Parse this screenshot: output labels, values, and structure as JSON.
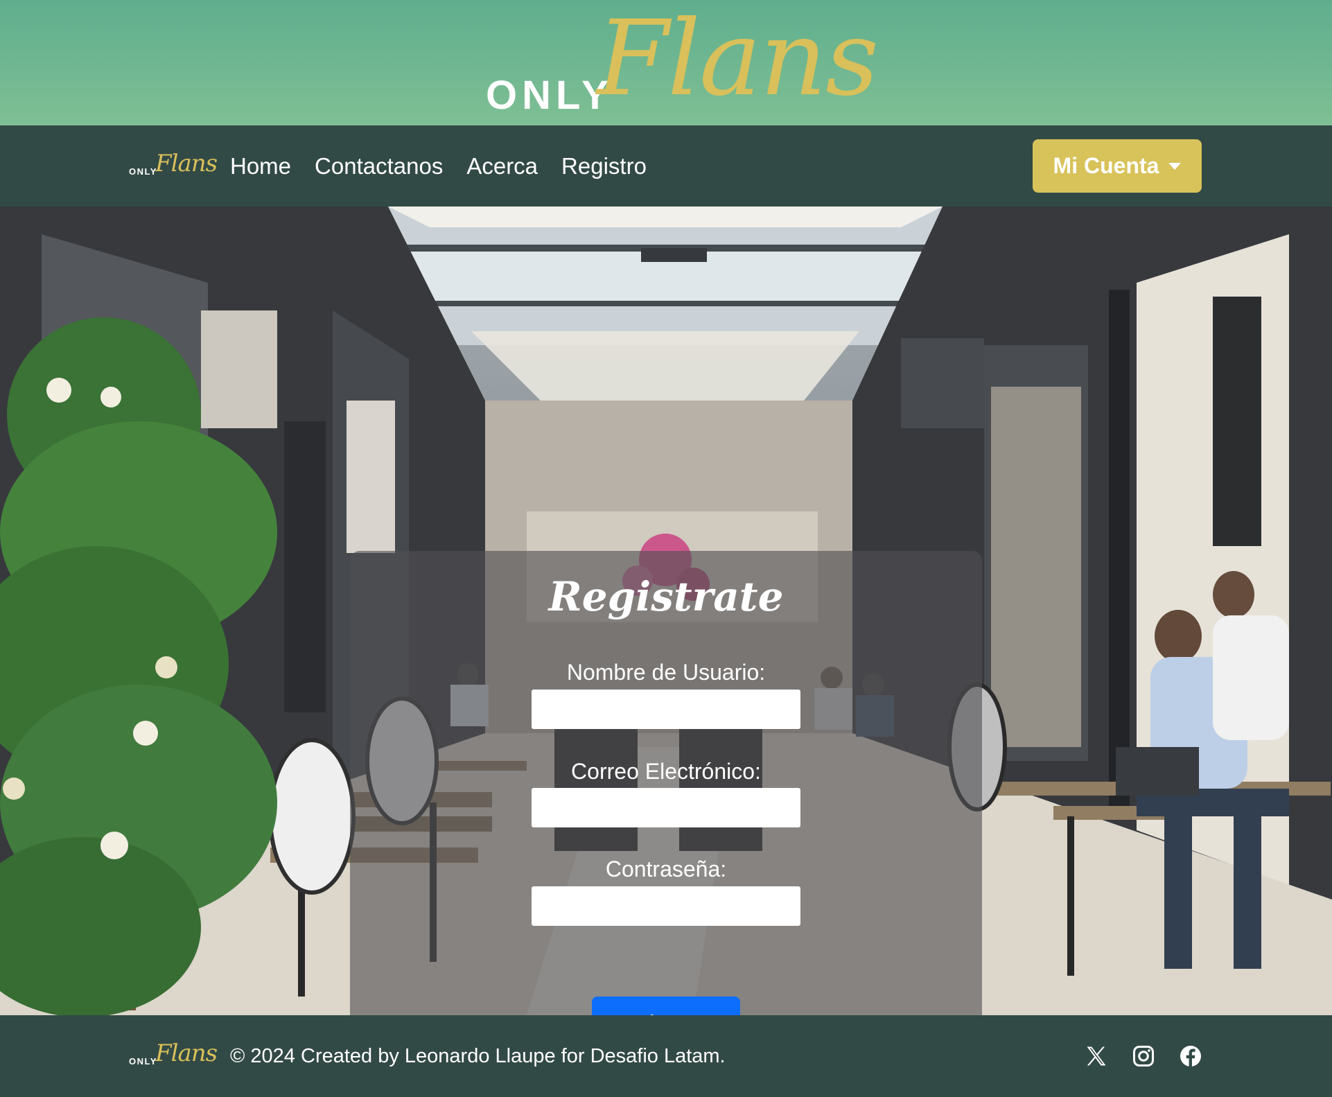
{
  "brand": {
    "only": "ONLY",
    "flans": "Flans"
  },
  "nav": {
    "links": [
      "Home",
      "Contactanos",
      "Acerca",
      "Registro"
    ],
    "account_label": "Mi Cuenta"
  },
  "form": {
    "title": "Registrate",
    "username_label": "Nombre de Usuario:",
    "username_value": "",
    "email_label": "Correo Electrónico:",
    "email_value": "",
    "password_label": "Contraseña:",
    "password_value": "",
    "submit_label": "Registrarse"
  },
  "footer": {
    "copyright": "© 2024 Created by Leonardo Llaupe for Desafio Latam.",
    "social_icons": [
      "x-icon",
      "instagram-icon",
      "facebook-icon"
    ]
  },
  "colors": {
    "banner": "#6db690",
    "navbar": "#324a46",
    "accent_gold": "#d8c25a",
    "primary_button": "#0d6efd"
  }
}
